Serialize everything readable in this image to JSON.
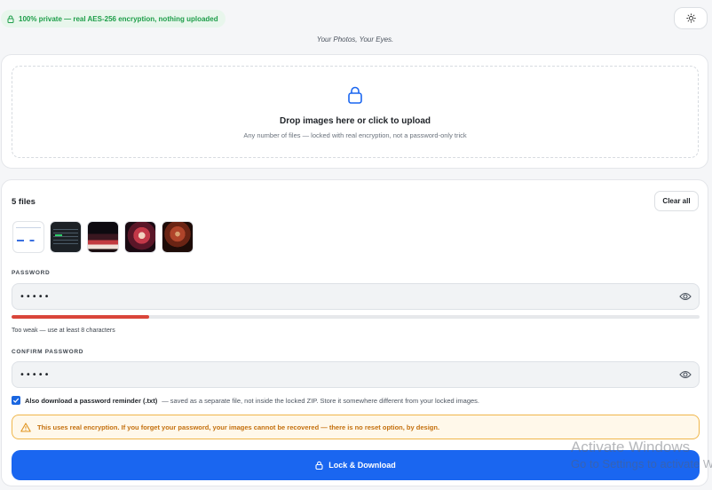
{
  "header": {
    "privacy_badge": "100% private — real AES-256 encryption, nothing uploaded",
    "tagline": "Your Photos, Your Eyes."
  },
  "upload": {
    "title": "Drop images here or click to upload",
    "subtitle": "Any number of files — locked with real encryption, not a password-only trick"
  },
  "files": {
    "count_label": "5 files",
    "clear_label": "Clear all",
    "thumbnails": [
      "thumb-1",
      "thumb-2",
      "thumb-3",
      "thumb-4",
      "thumb-5"
    ]
  },
  "password": {
    "label": "PASSWORD",
    "value": "•••••",
    "strength_fraction": 0.2,
    "strength_text": "Too weak — use at least 8 characters"
  },
  "confirm": {
    "label": "CONFIRM PASSWORD",
    "value": "•••••"
  },
  "reminder": {
    "checked": true,
    "strong": "Also download a password reminder (.txt)",
    "rest": "— saved as a separate file, not inside the locked ZIP. Store it somewhere different from your locked images."
  },
  "warning": {
    "text": "This uses real encryption. If you forget your password, your images cannot be recovered — there is no reset option, by design."
  },
  "action": {
    "label": "Lock & Download"
  },
  "watermark": {
    "line1": "Activate Windows",
    "line2": "Go to Settings to activate Windows."
  },
  "colors": {
    "accent": "#1a66f0",
    "success": "#1e9e4a",
    "danger": "#d9453a",
    "warning": "#c4700e"
  },
  "icons": {
    "badge": "lock-icon",
    "theme": "sun-icon",
    "upload": "lock-icon",
    "visibility": "eye-icon",
    "warning": "warning-triangle-icon",
    "action": "lock-icon"
  }
}
